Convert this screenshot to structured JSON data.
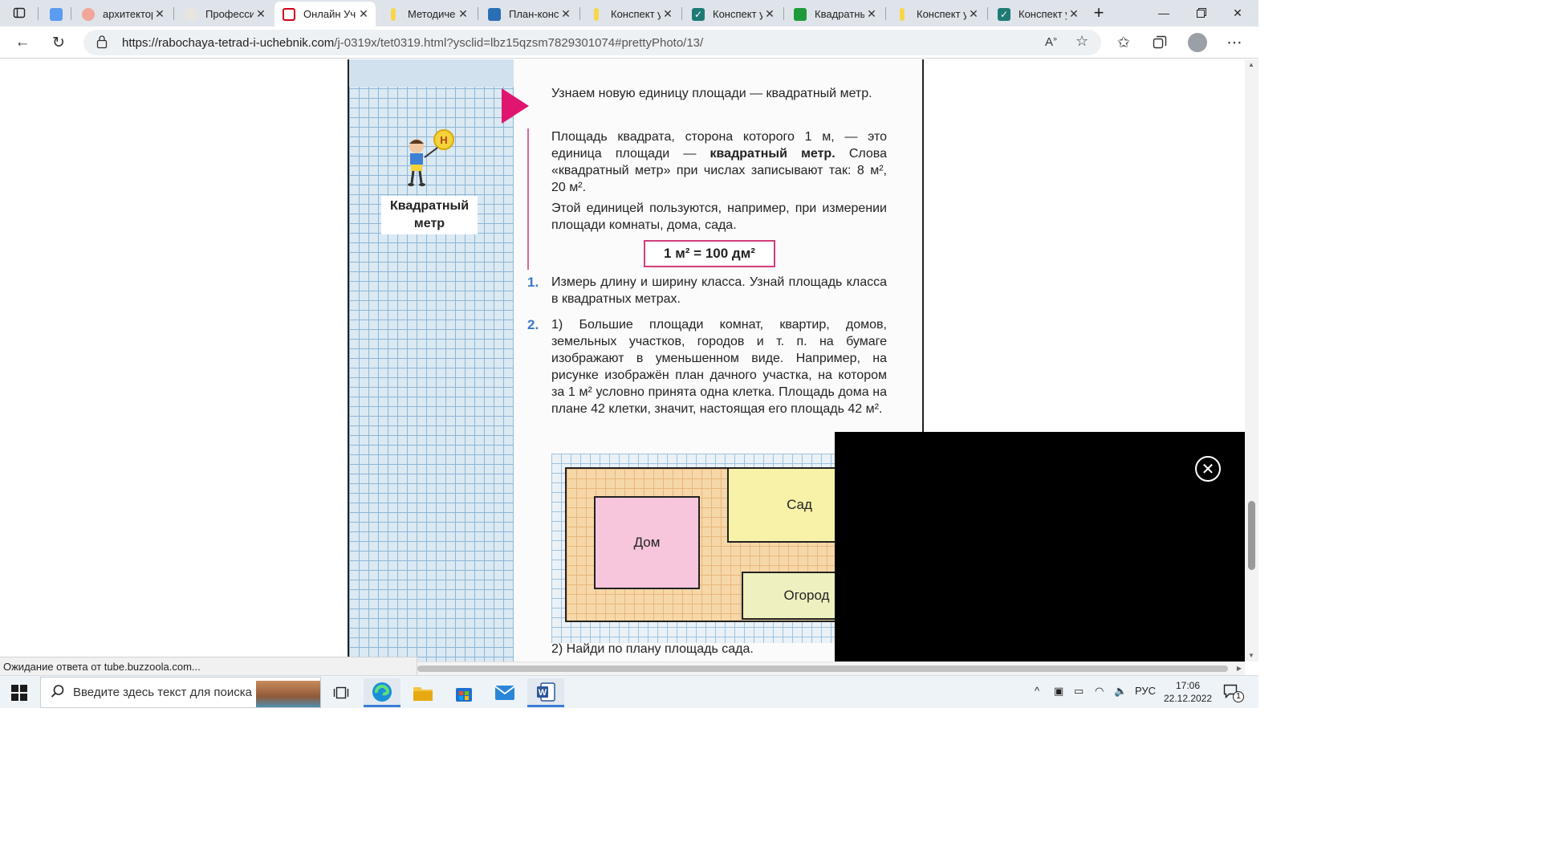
{
  "browser": {
    "tabs": [
      {
        "label": "",
        "kind": "tab-actions"
      },
      {
        "label": "",
        "favicon": "chat-icon"
      },
      {
        "label": "архитектор",
        "favicon": "yandex-icon"
      },
      {
        "label": "Професси",
        "favicon": "pencil-icon"
      },
      {
        "label": "Онлайн Уч",
        "favicon": "book-icon",
        "active": true
      },
      {
        "label": "Методичес",
        "favicon": "doc-yellow-icon"
      },
      {
        "label": "План-конс",
        "favicon": "book-blue-icon"
      },
      {
        "label": "Конспект у",
        "favicon": "doc-yellow-icon"
      },
      {
        "label": "Конспект у",
        "favicon": "check-icon"
      },
      {
        "label": "Квадратны",
        "favicon": "doc-green-icon"
      },
      {
        "label": "Конспект у",
        "favicon": "doc-yellow-icon"
      },
      {
        "label": "Конспект у",
        "favicon": "check-icon"
      }
    ],
    "url_host": "https://rabochaya-tetrad-i-uchebnik.com",
    "url_path": "/j-0319x/tet0319.html?ysclid=lbz15qzsm7829301074#prettyPhoto/13/",
    "status_text": "Ожидание ответа от tube.buzzoola.com..."
  },
  "page": {
    "term_label": "Квадратный метр",
    "intro": "Узнаем новую единицу площади — квадратный метр.",
    "para1_a": "Площадь квадрата, сторона которого 1 м, — это единица площади — ",
    "para1_bold": "квадратный метр.",
    "para1_b": " Слова «квадратный метр» при числах записывают так: 8 м², 20 м².",
    "para2": "Этой единицей пользуются, например, при измерении площади комнаты, дома, сада.",
    "formula": "1 м² = 100 дм²",
    "task1_num": "1.",
    "task1": "Измерь длину и ширину класса. Узнай площадь класса в квадратных метрах.",
    "task2_num": "2.",
    "task2": "1) Большие площади комнат, квартир, домов, земельных участков, городов и т. п. на бумаге изображают в уменьшенном виде. Например, на рисунке изображён план дачного участка, на котором за 1 м² условно принята одна клетка. Площадь дома на плане 42 клетки, значит, настоящая его площадь 42 м².",
    "plan": {
      "house": "Дом",
      "garden": "Сад",
      "vegetable": "Огород"
    },
    "task2_part2": "2) Найди по плану площадь сада."
  },
  "taskbar": {
    "search_placeholder": "Введите здесь текст для поиска",
    "lang": "РУС",
    "time": "17:06",
    "date": "22.12.2022",
    "notifications": "1"
  },
  "colors": {
    "accent_pink": "#e0156f",
    "task_blue": "#3a79c5",
    "ad_overlay": "#000000"
  }
}
